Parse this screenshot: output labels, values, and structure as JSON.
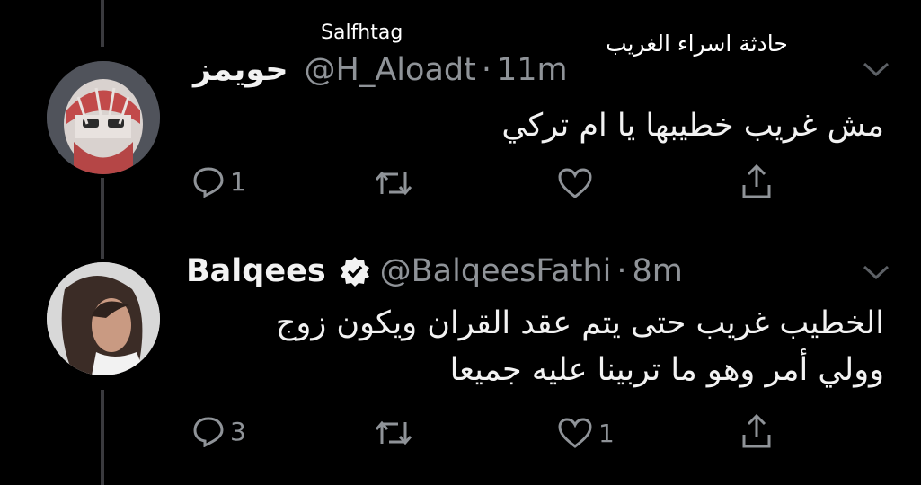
{
  "overlays": {
    "top_label": "Salfhtag",
    "top_right_title": "حادثة اسراء الغريب"
  },
  "tweets": [
    {
      "display_name": "حويمز",
      "handle": "@H_Aloadt",
      "separator": "·",
      "time": "11m",
      "body_lines": [
        "مش غريب خطيبها يا ام تركي"
      ],
      "reply_count": "1",
      "retweet_count": "",
      "like_count": "",
      "verified": false
    },
    {
      "display_name": "Balqees",
      "handle": "@BalqeesFathi",
      "separator": "·",
      "time": "8m",
      "body_lines": [
        "الخطيب غريب حتى يتم عقد القران ويكون زوج",
        "وولي أمر وهو ما تربينا عليه جميعا"
      ],
      "reply_count": "3",
      "retweet_count": "",
      "like_count": "1",
      "verified": true
    }
  ],
  "icons": {
    "reply": "reply-icon",
    "retweet": "retweet-icon",
    "like": "heart-icon",
    "share": "share-icon",
    "more": "chevron-down-icon",
    "verified": "verified-badge-icon"
  },
  "colors": {
    "background": "#000000",
    "text_primary": "#f2f2f2",
    "text_secondary": "#8f9398",
    "thread_line": "#3a3a3e"
  }
}
